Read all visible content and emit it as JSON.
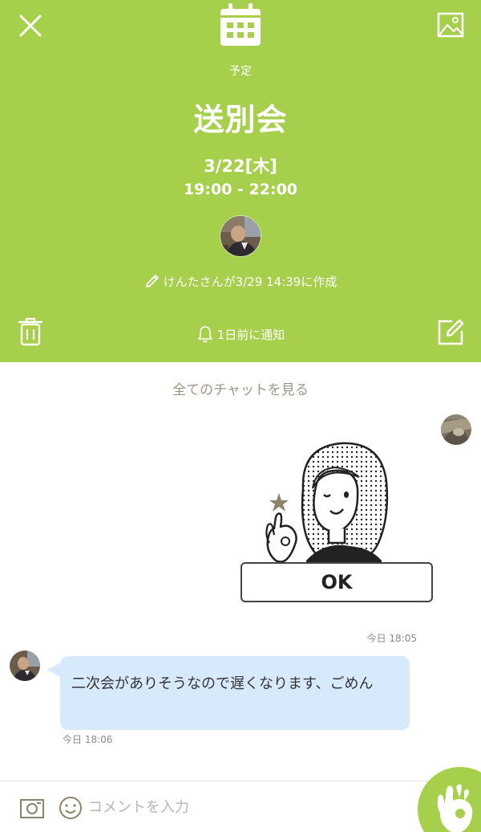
{
  "header": {
    "type_label": "予定",
    "title": "送別会",
    "date": "3/22[木]",
    "time": "19:00 - 22:00",
    "created_text": "けんたさんが3/29 14:39に作成",
    "notify_text": "1日前に通知",
    "background_color": "#a6cf4c"
  },
  "chat": {
    "see_all_label": "全てのチャットを見る",
    "sticker_text": "OK",
    "sticker_time": "今日 18:05",
    "message_text": "二次会がありそうなので遅くなります、ごめん",
    "message_time": "今日 18:06",
    "bubble_color": "#d7eafc"
  },
  "input": {
    "placeholder": "コメントを入力"
  },
  "icons": [
    "close-icon",
    "calendar-icon",
    "image-icon",
    "pencil-icon",
    "trash-icon",
    "bell-icon",
    "edit-icon",
    "camera-icon",
    "emoji-icon",
    "ok-hand-icon"
  ]
}
